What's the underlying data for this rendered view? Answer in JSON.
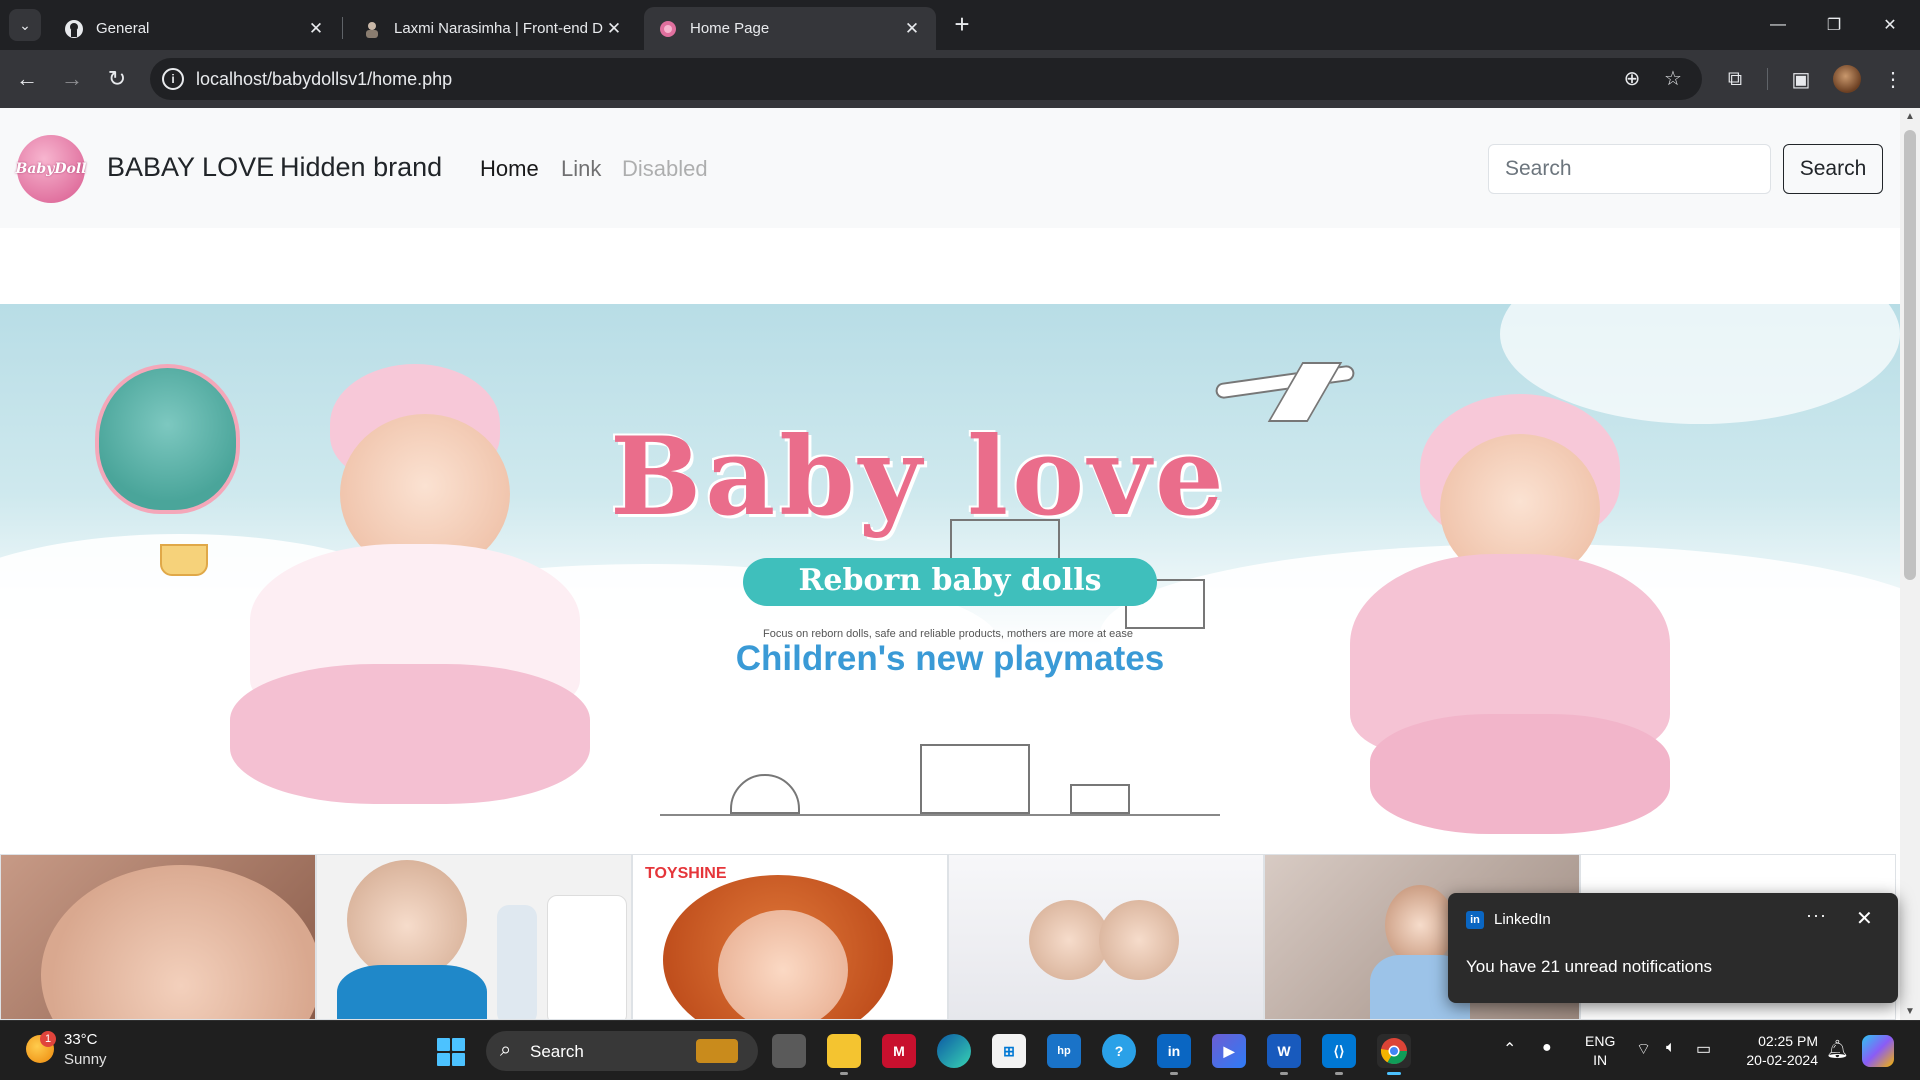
{
  "browser": {
    "tabs": [
      {
        "title": "General",
        "icon": "github-icon",
        "active": false
      },
      {
        "title": "Laxmi Narasimha | Front-end D",
        "icon": "profile-favicon-icon",
        "active": false
      },
      {
        "title": "Home Page",
        "icon": "babydoll-favicon-icon",
        "active": true
      }
    ],
    "tab_close": "✕",
    "new_tab": "+",
    "url": "localhost/babydollsv1/home.php",
    "window": {
      "minimize": "—",
      "restore": "❐",
      "close": "✕"
    }
  },
  "page": {
    "logo_text": "BabyDoll",
    "brand_primary": "BABAY LOVE",
    "brand_secondary": "Hidden brand",
    "nav_links": [
      {
        "label": "Home",
        "state": "active"
      },
      {
        "label": "Link",
        "state": "normal"
      },
      {
        "label": "Disabled",
        "state": "disabled"
      }
    ],
    "search": {
      "placeholder": "Search",
      "button": "Search"
    },
    "hero": {
      "title": "Baby love",
      "ribbon": "Reborn baby dolls",
      "tagline": "Focus on reborn dolls, safe and reliable products, mothers are more at ease",
      "subtitle": "Children's new playmates",
      "prev_control": "‹",
      "next_control": "›"
    },
    "thumbnails": [
      {
        "name": "doll-closeup"
      },
      {
        "name": "boy-doll-with-bottle"
      },
      {
        "name": "toyshine-redhead-doll",
        "badge": "TOYSHINE"
      },
      {
        "name": "twin-dolls"
      },
      {
        "name": "doll-in-blue-dress"
      },
      {
        "name": "doll-six"
      }
    ]
  },
  "notification": {
    "app": "LinkedIn",
    "message": "You have 21 unread notifications",
    "more": "···",
    "close": "✕"
  },
  "taskbar": {
    "weather": {
      "temp": "33°C",
      "desc": "Sunny",
      "badge": "1"
    },
    "search_label": "Search",
    "language": {
      "line1": "ENG",
      "line2": "IN"
    },
    "time": "02:25 PM",
    "date": "20-02-2024"
  },
  "colors": {
    "accent_pink": "#ea6d8b",
    "ribbon_teal": "#3fbfbc",
    "subtitle_blue": "#3a9ad6",
    "linkedin_blue": "#0a66c2"
  }
}
